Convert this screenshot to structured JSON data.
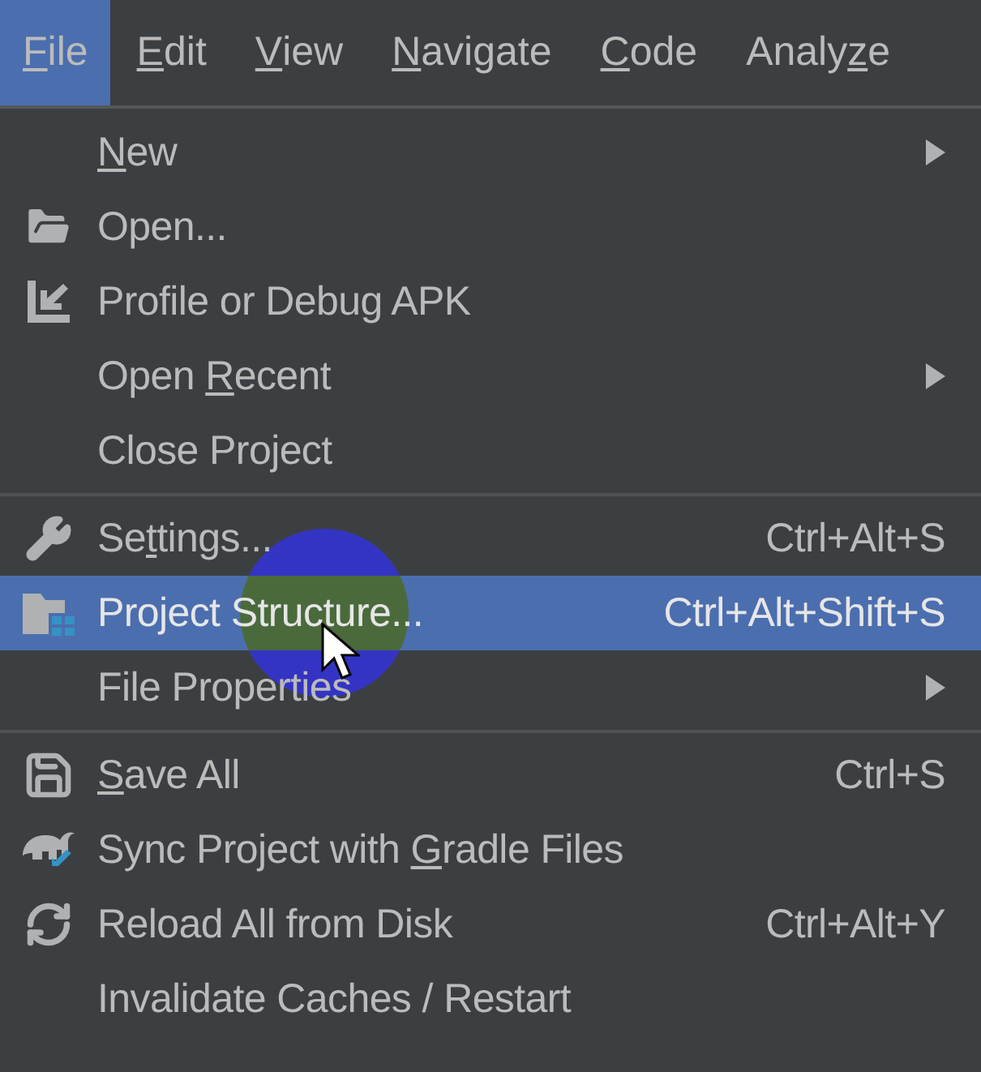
{
  "menu_bar": [
    {
      "label": {
        "key": "F",
        "post": "ile"
      },
      "selected": true
    },
    {
      "label": {
        "key": "E",
        "post": "dit"
      },
      "selected": false
    },
    {
      "label": {
        "key": "V",
        "post": "iew"
      },
      "selected": false
    },
    {
      "label": {
        "key": "N",
        "post": "avigate"
      },
      "selected": false
    },
    {
      "label": {
        "key": "C",
        "post": "ode"
      },
      "selected": false
    },
    {
      "label": {
        "pre": "Analy",
        "key": "z",
        "post": "e"
      },
      "selected": false
    }
  ],
  "file_menu": {
    "groups": [
      [
        {
          "label": {
            "key": "N",
            "post": "ew"
          },
          "submenu": true,
          "selected": false
        },
        {
          "label": {
            "pre": "Open..."
          },
          "submenu": false,
          "selected": false
        },
        {
          "label": {
            "pre": "Profile or Debug APK"
          },
          "submenu": false,
          "selected": false
        },
        {
          "label": {
            "pre": "Open ",
            "key": "R",
            "post": "ecent"
          },
          "submenu": true,
          "selected": false
        },
        {
          "label": {
            "pre": "Close Project"
          },
          "submenu": false,
          "selected": false
        }
      ],
      [
        {
          "label": {
            "pre": "Se",
            "key": "t",
            "post": "tings..."
          },
          "shortcut": "Ctrl+Alt+S",
          "submenu": false,
          "selected": false
        },
        {
          "label": {
            "pre": "Project Structure..."
          },
          "shortcut": "Ctrl+Alt+Shift+S",
          "submenu": false,
          "selected": true
        },
        {
          "label": {
            "pre": "File Properties"
          },
          "submenu": true,
          "selected": false
        }
      ],
      [
        {
          "label": {
            "key": "S",
            "post": "ave All"
          },
          "shortcut": "Ctrl+S",
          "submenu": false,
          "selected": false
        },
        {
          "label": {
            "pre": "Sync Project with ",
            "key": "G",
            "post": "radle Files"
          },
          "submenu": false,
          "selected": false
        },
        {
          "label": {
            "pre": "Reload All from Disk"
          },
          "shortcut": "Ctrl+Alt+Y",
          "submenu": false,
          "selected": false
        },
        {
          "label": {
            "pre": "Invalidate Caches / Restart"
          },
          "submenu": false,
          "selected": false
        }
      ]
    ]
  }
}
